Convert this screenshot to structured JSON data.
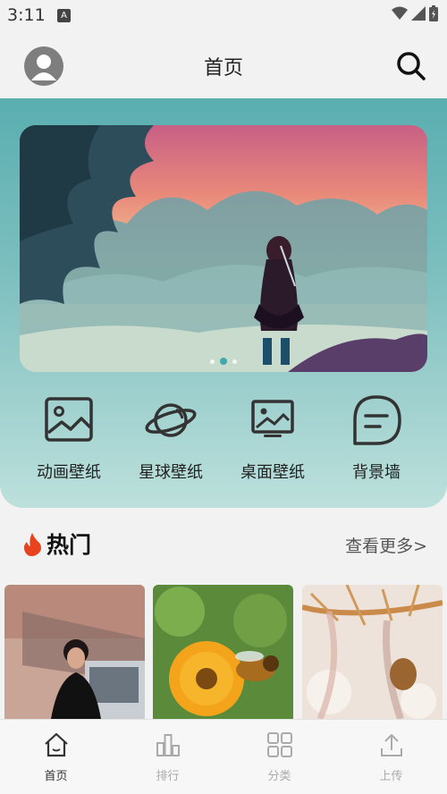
{
  "status": {
    "time": "3:11"
  },
  "header": {
    "title": "首页"
  },
  "banner": {
    "slide_count": 3,
    "active_index": 1
  },
  "categories": [
    {
      "label": "动画壁纸",
      "icon": "image-icon"
    },
    {
      "label": "星球壁纸",
      "icon": "planet-icon"
    },
    {
      "label": "桌面壁纸",
      "icon": "desktop-image-icon"
    },
    {
      "label": "背景墙",
      "icon": "chat-bubble-icon"
    }
  ],
  "hot": {
    "title": "热门",
    "more": "查看更多>"
  },
  "tabs": [
    {
      "label": "首页",
      "icon": "home-icon",
      "active": true
    },
    {
      "label": "排行",
      "icon": "bar-chart-icon",
      "active": false
    },
    {
      "label": "分类",
      "icon": "grid-icon",
      "active": false
    },
    {
      "label": "上传",
      "icon": "upload-icon",
      "active": false
    }
  ],
  "colors": {
    "accent": "#3fa9ad",
    "hero_top": "#5aaeb0",
    "hero_bottom": "#bde0dc",
    "fire": "#e8421f"
  }
}
